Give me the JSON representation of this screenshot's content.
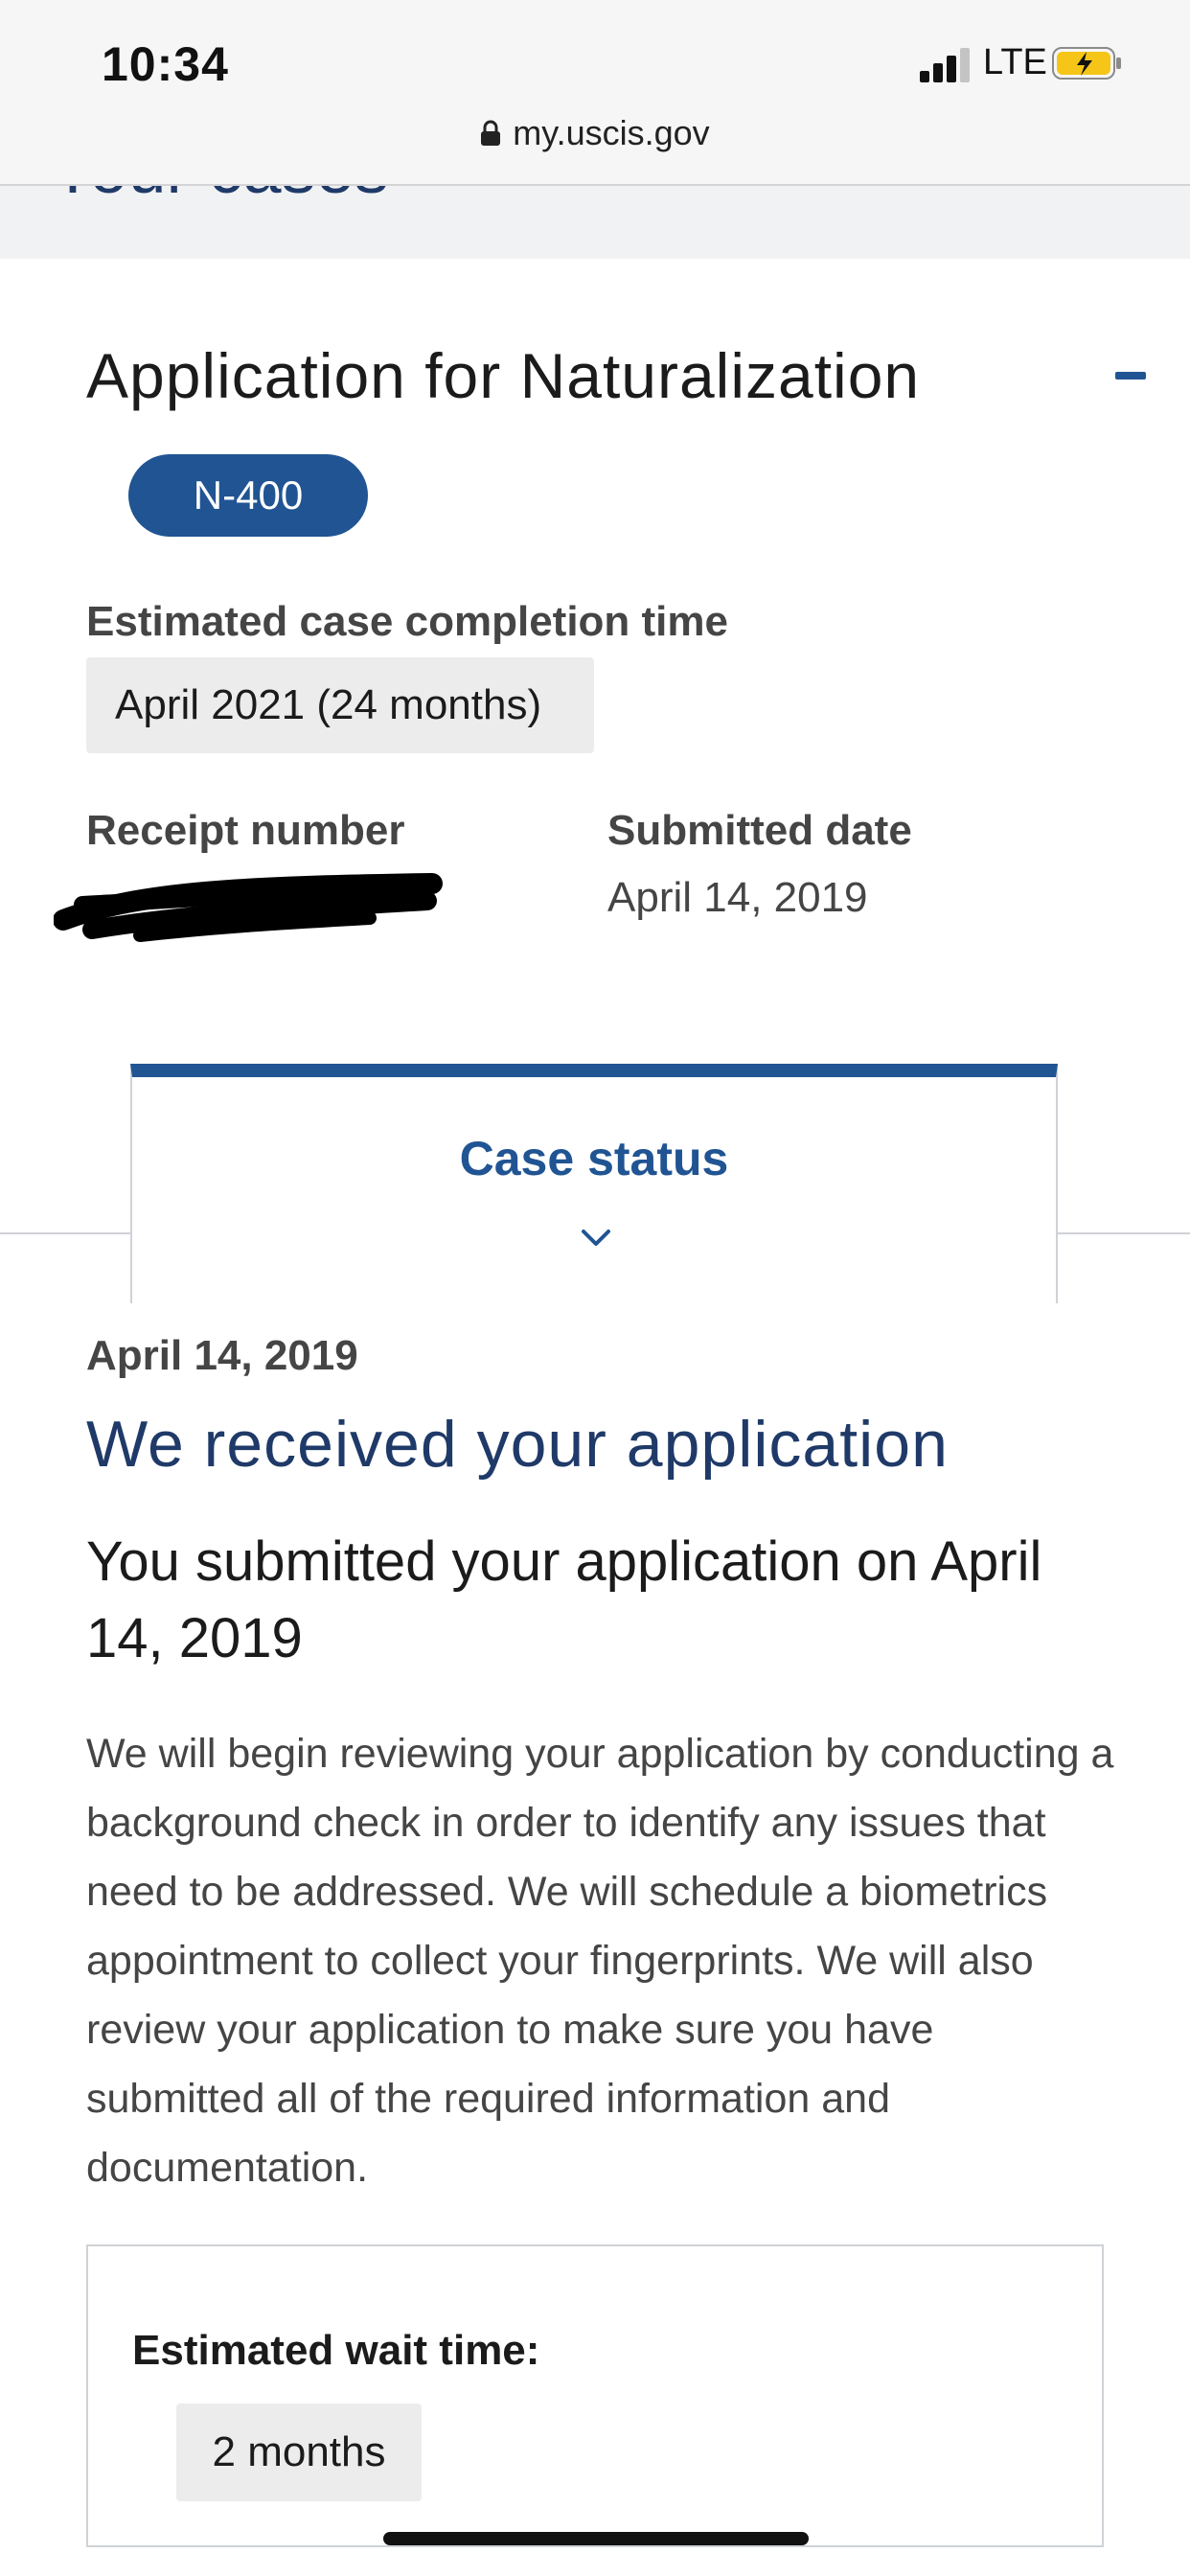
{
  "status_bar": {
    "time": "10:34",
    "network": "LTE",
    "icons": [
      "signal-icon",
      "battery-charging-icon"
    ]
  },
  "browser": {
    "url": "my.uscis.gov",
    "icons": [
      "lock-icon"
    ]
  },
  "page": {
    "header_title": "Your cases"
  },
  "case": {
    "title": "Application for Naturalization",
    "form_badge": "N-400",
    "completion_label": "Estimated case completion time",
    "completion_value": "April 2021 (24 months)",
    "receipt_label": "Receipt number",
    "submitted_label": "Submitted date",
    "submitted_value": "April 14, 2019"
  },
  "tabs": {
    "case_status_label": "Case status"
  },
  "status": {
    "date": "April 14, 2019",
    "heading": "We received your application",
    "subheading": "You submitted your application on April 14, 2019",
    "body": "We will begin reviewing your application by conducting a background check in order to identify any issues that need to be addressed. We will schedule a biometrics appointment to collect your fingerprints. We will also review your application to make sure you have submitted all of the required information and documentation.",
    "wait_label": "Estimated wait time:",
    "wait_value": "2 months"
  },
  "colors": {
    "primary": "#205493",
    "heading": "#1f3a68",
    "chip_bg": "#ececec",
    "text_muted": "#454545"
  }
}
